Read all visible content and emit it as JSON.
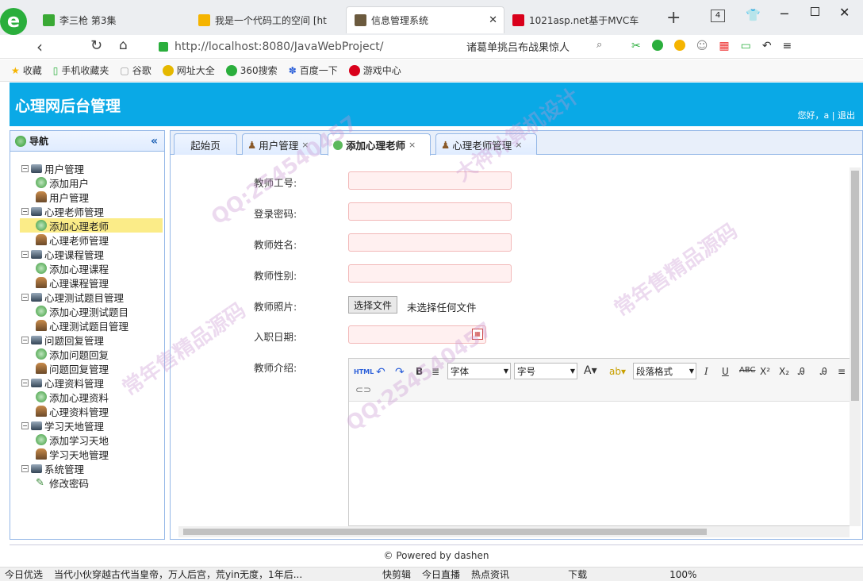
{
  "browser": {
    "tabs": [
      {
        "title": "李三枪 第3集",
        "icon_color": "#3aa935"
      },
      {
        "title": "我是一个代码工的空间 [ht",
        "icon_color": "#f5b400"
      },
      {
        "title": "信息管理系统",
        "icon_color": "#6b5a3e",
        "active": true
      },
      {
        "title": "1021asp.net基于MVC车",
        "icon_color": "#d9001b"
      }
    ],
    "new_tab": "+",
    "tab_count": "4",
    "address": "http://localhost:8080/JavaWebProject/",
    "search_text": "诸葛单挑吕布战果惊人",
    "bookmarks": [
      "收藏",
      "手机收藏夹",
      "谷歌",
      "网址大全",
      "360搜索",
      "百度一下",
      "游戏中心"
    ]
  },
  "app": {
    "title": "心理网后台管理",
    "greeting": "您好，a |",
    "logout": "退出",
    "nav_title": "导航",
    "tree": [
      {
        "label": "用户管理",
        "level": 0
      },
      {
        "label": "添加用户",
        "level": 1,
        "icon": "add"
      },
      {
        "label": "用户管理",
        "level": 1,
        "icon": "user"
      },
      {
        "label": "心理老师管理",
        "level": 0
      },
      {
        "label": "添加心理老师",
        "level": 1,
        "icon": "add",
        "selected": true
      },
      {
        "label": "心理老师管理",
        "level": 1,
        "icon": "user"
      },
      {
        "label": "心理课程管理",
        "level": 0
      },
      {
        "label": "添加心理课程",
        "level": 1,
        "icon": "add"
      },
      {
        "label": "心理课程管理",
        "level": 1,
        "icon": "user"
      },
      {
        "label": "心理测试题目管理",
        "level": 0
      },
      {
        "label": "添加心理测试题目",
        "level": 1,
        "icon": "add"
      },
      {
        "label": "心理测试题目管理",
        "level": 1,
        "icon": "user"
      },
      {
        "label": "问题回复管理",
        "level": 0
      },
      {
        "label": "添加问题回复",
        "level": 1,
        "icon": "add"
      },
      {
        "label": "问题回复管理",
        "level": 1,
        "icon": "user"
      },
      {
        "label": "心理资料管理",
        "level": 0
      },
      {
        "label": "添加心理资料",
        "level": 1,
        "icon": "add"
      },
      {
        "label": "心理资料管理",
        "level": 1,
        "icon": "user"
      },
      {
        "label": "学习天地管理",
        "level": 0
      },
      {
        "label": "添加学习天地",
        "level": 1,
        "icon": "add"
      },
      {
        "label": "学习天地管理",
        "level": 1,
        "icon": "user"
      },
      {
        "label": "系统管理",
        "level": 0
      },
      {
        "label": "修改密码",
        "level": 1,
        "icon": "pencil"
      }
    ],
    "tabs": [
      {
        "label": "起始页",
        "closable": false
      },
      {
        "label": "用户管理",
        "closable": true
      },
      {
        "label": "添加心理老师",
        "closable": true,
        "active": true
      },
      {
        "label": "心理老师管理",
        "closable": true
      }
    ],
    "form": {
      "fields": [
        {
          "label": "教师工号:",
          "value": ""
        },
        {
          "label": "登录密码:",
          "value": ""
        },
        {
          "label": "教师姓名:",
          "value": ""
        },
        {
          "label": "教师性别:",
          "value": ""
        }
      ],
      "photo_label": "教师照片:",
      "file_button": "选择文件",
      "file_status": "未选择任何文件",
      "date_label": "入职日期:",
      "intro_label": "教师介绍:"
    },
    "editor": {
      "font_family": "字体",
      "font_size": "字号",
      "paragraph": "段落格式",
      "html_label": "HTML"
    },
    "footer": "© Powered by dashen"
  },
  "statusbar": {
    "items": [
      "今日优选",
      "当代小伙穿越古代当皇帝，万人后宫，荒yin无度，1年后...",
      "快剪辑",
      "今日直播",
      "热点资讯",
      "下载",
      "100%"
    ]
  },
  "watermark": {
    "qq": "QQ:254540457",
    "a": "大神计算机设计",
    "b": "常年售精品源码"
  }
}
